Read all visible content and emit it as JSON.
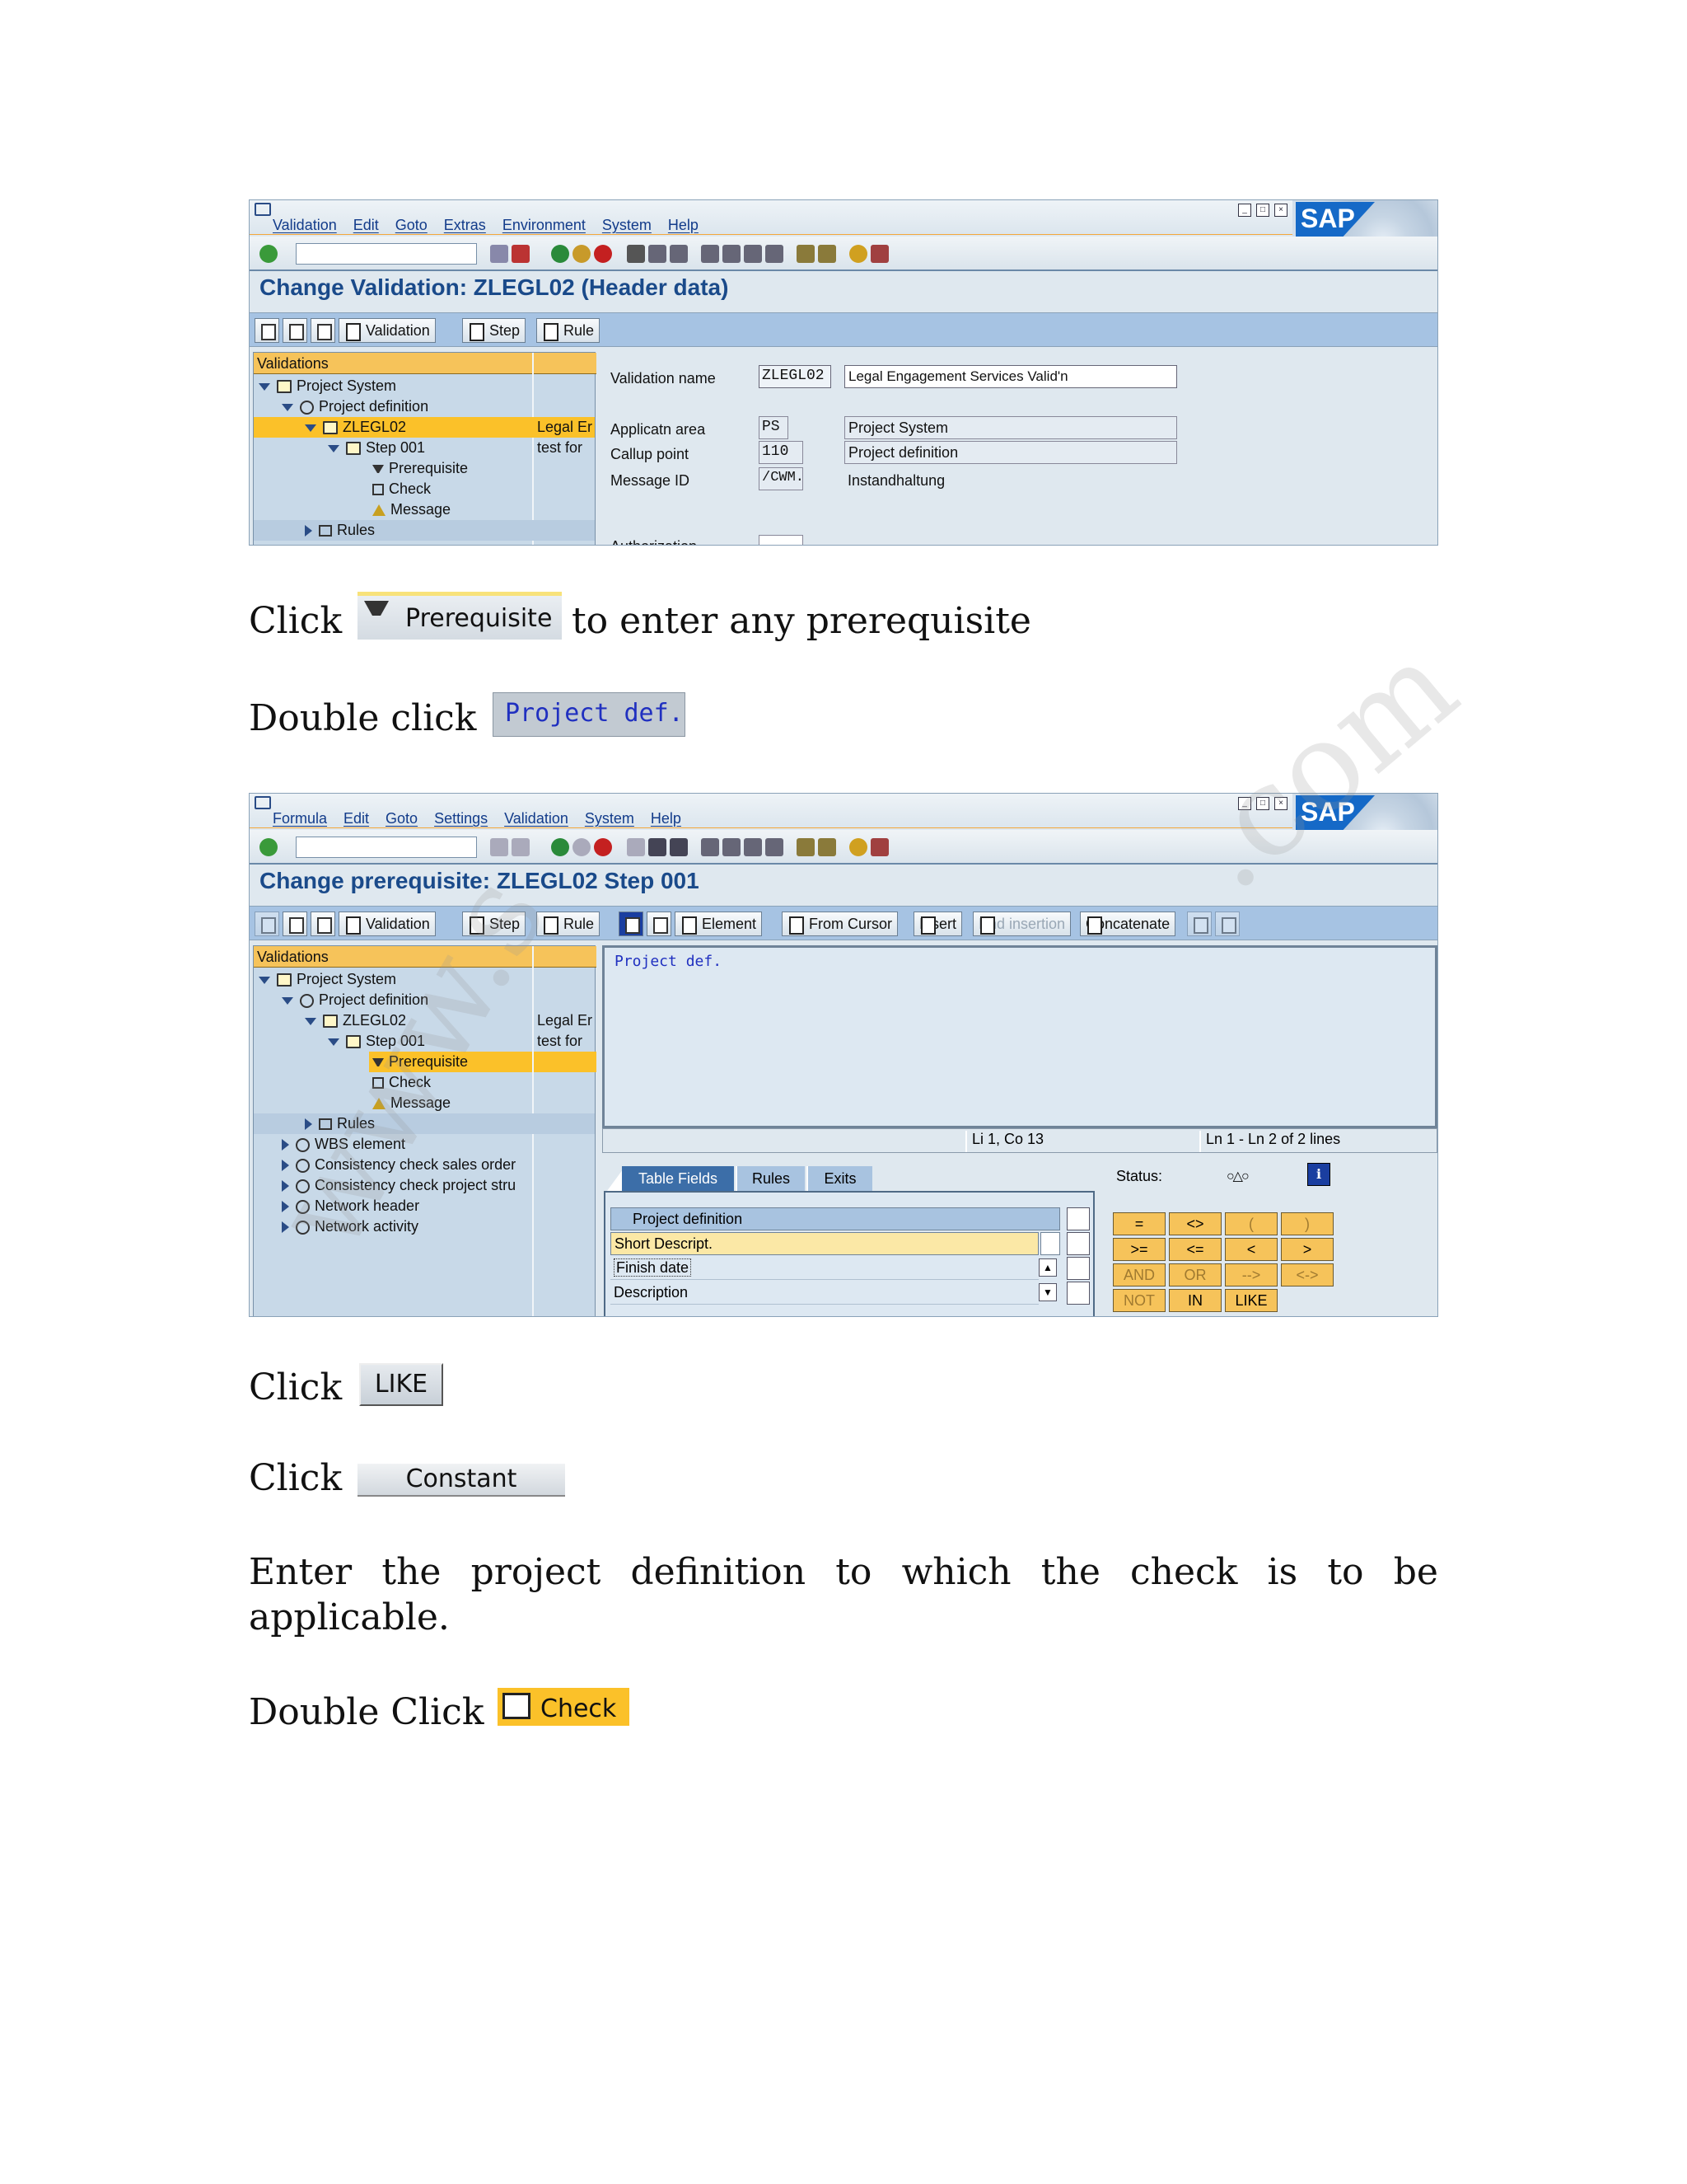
{
  "window1": {
    "menu": [
      "Validation",
      "Edit",
      "Goto",
      "Extras",
      "Environment",
      "System",
      "Help"
    ],
    "title": "Change Validation: ZLEGL02 (Header data)",
    "app_buttons": [
      "Validation",
      "Step",
      "Rule"
    ],
    "tree": {
      "header": "Validations",
      "rows": [
        {
          "label": "Project System",
          "col2": ""
        },
        {
          "label": "Project definition",
          "col2": ""
        },
        {
          "label": "ZLEGL02",
          "col2": "Legal Er"
        },
        {
          "label": "Step 001",
          "col2": "test for"
        },
        {
          "label": "Prerequisite",
          "col2": ""
        },
        {
          "label": "Check",
          "col2": ""
        },
        {
          "label": "Message",
          "col2": ""
        },
        {
          "label": "Rules",
          "col2": ""
        }
      ]
    },
    "form": {
      "validation_name_label": "Validation name",
      "validation_name_value": "ZLEGL02",
      "validation_desc": "Legal Engagement Services Valid'n",
      "appl_area_label": "Applicatn area",
      "appl_area_value": "PS",
      "appl_area_desc": "Project System",
      "callup_label": "Callup point",
      "callup_value": "110",
      "callup_desc": "Project definition",
      "msgid_label": "Message ID",
      "msgid_value": "/CWM.",
      "msgid_desc": "Instandhaltung",
      "auth_label": "Authorization"
    }
  },
  "text1": {
    "click": "Click",
    "prereq_btn": "Prerequisite",
    "rest": "to enter any prerequisite"
  },
  "text2": {
    "double_click": "Double click",
    "projdef_btn": "Project def."
  },
  "window2": {
    "menu": [
      "Formula",
      "Edit",
      "Goto",
      "Settings",
      "Validation",
      "System",
      "Help"
    ],
    "title": "Change prerequisite: ZLEGL02 Step 001",
    "app_buttons": [
      "Validation",
      "Step",
      "Rule",
      "Element",
      "From Cursor",
      "Insert",
      "End insertion",
      "Concatenate"
    ],
    "tree": {
      "header": "Validations",
      "rows": [
        {
          "label": "Project System",
          "col2": ""
        },
        {
          "label": "Project definition",
          "col2": ""
        },
        {
          "label": "ZLEGL02",
          "col2": "Legal Er"
        },
        {
          "label": "Step 001",
          "col2": "test for"
        },
        {
          "label": "Prerequisite",
          "col2": ""
        },
        {
          "label": "Check",
          "col2": ""
        },
        {
          "label": "Message",
          "col2": ""
        },
        {
          "label": "Rules",
          "col2": ""
        },
        {
          "label": "WBS element",
          "col2": ""
        },
        {
          "label": "Consistency check sales order",
          "col2": ""
        },
        {
          "label": "Consistency check project stru",
          "col2": ""
        },
        {
          "label": "Network header",
          "col2": ""
        },
        {
          "label": "Network activity",
          "col2": ""
        }
      ]
    },
    "editor_text": "Project def.",
    "status_cursor": "Li 1, Co 13",
    "status_lines": "Ln 1 - Ln 2 of 2 lines",
    "tabs": [
      "Table Fields",
      "Rules",
      "Exits"
    ],
    "status_label": "Status:",
    "field_header": "Project definition",
    "fields": [
      "Short Descript.",
      "Finish date",
      "Description"
    ],
    "operators": [
      "=",
      "<>",
      "(",
      ")",
      ">=",
      "<=",
      "<",
      ">",
      "AND",
      "OR",
      "-->",
      "<->",
      "NOT",
      "IN",
      "LIKE"
    ]
  },
  "text3": {
    "click": "Click",
    "like_btn": "LIKE"
  },
  "text4": {
    "click": "Click",
    "constant_btn": "Constant"
  },
  "text5": {
    "line1": [
      "Enter",
      "the",
      "project",
      "definition",
      "to",
      "which",
      "the",
      "check",
      "is",
      "to",
      "be"
    ],
    "line2": "applicable."
  },
  "text6": {
    "double_click": "Double Click",
    "check_btn": "Check"
  },
  "watermark": "www.s",
  "watermark2": ".com",
  "colors": {
    "sap_title": "#1a4a8a",
    "highlight": "#fbc129",
    "app_toolbar": "#a6c3e3"
  }
}
